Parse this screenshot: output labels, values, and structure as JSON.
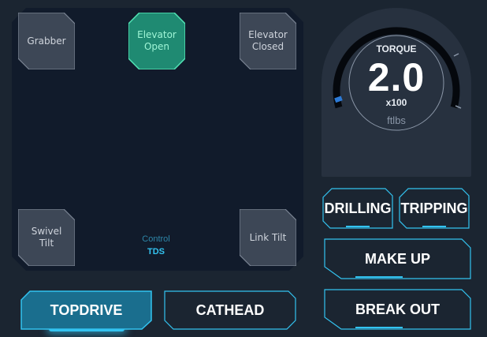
{
  "controls": {
    "grabber": "Grabber",
    "elevator_open": "Elevator\nOpen",
    "elevator_closed": "Elevator\nClosed",
    "swivel_tilt": "Swivel\nTilt",
    "link_tilt": "Link Tilt",
    "control_label": "Control",
    "control_value": "TDS"
  },
  "gauge": {
    "title": "TORQUE",
    "value": "2.0",
    "multiplier": "x100",
    "unit": "ftlbs"
  },
  "modes": {
    "drilling": "DRILLING",
    "tripping": "TRIPPING",
    "make_up": "MAKE UP",
    "break_out": "BREAK OUT"
  },
  "tabs": {
    "topdrive": "TOPDRIVE",
    "cathead": "CATHEAD",
    "active": "TOPDRIVE"
  },
  "colors": {
    "accent": "#33c3f0",
    "active_green": "#2fd3a0",
    "panel": "#111b2b",
    "background": "#1b2531"
  },
  "icons": {
    "gauge_marker": "torque-indicator-icon"
  }
}
